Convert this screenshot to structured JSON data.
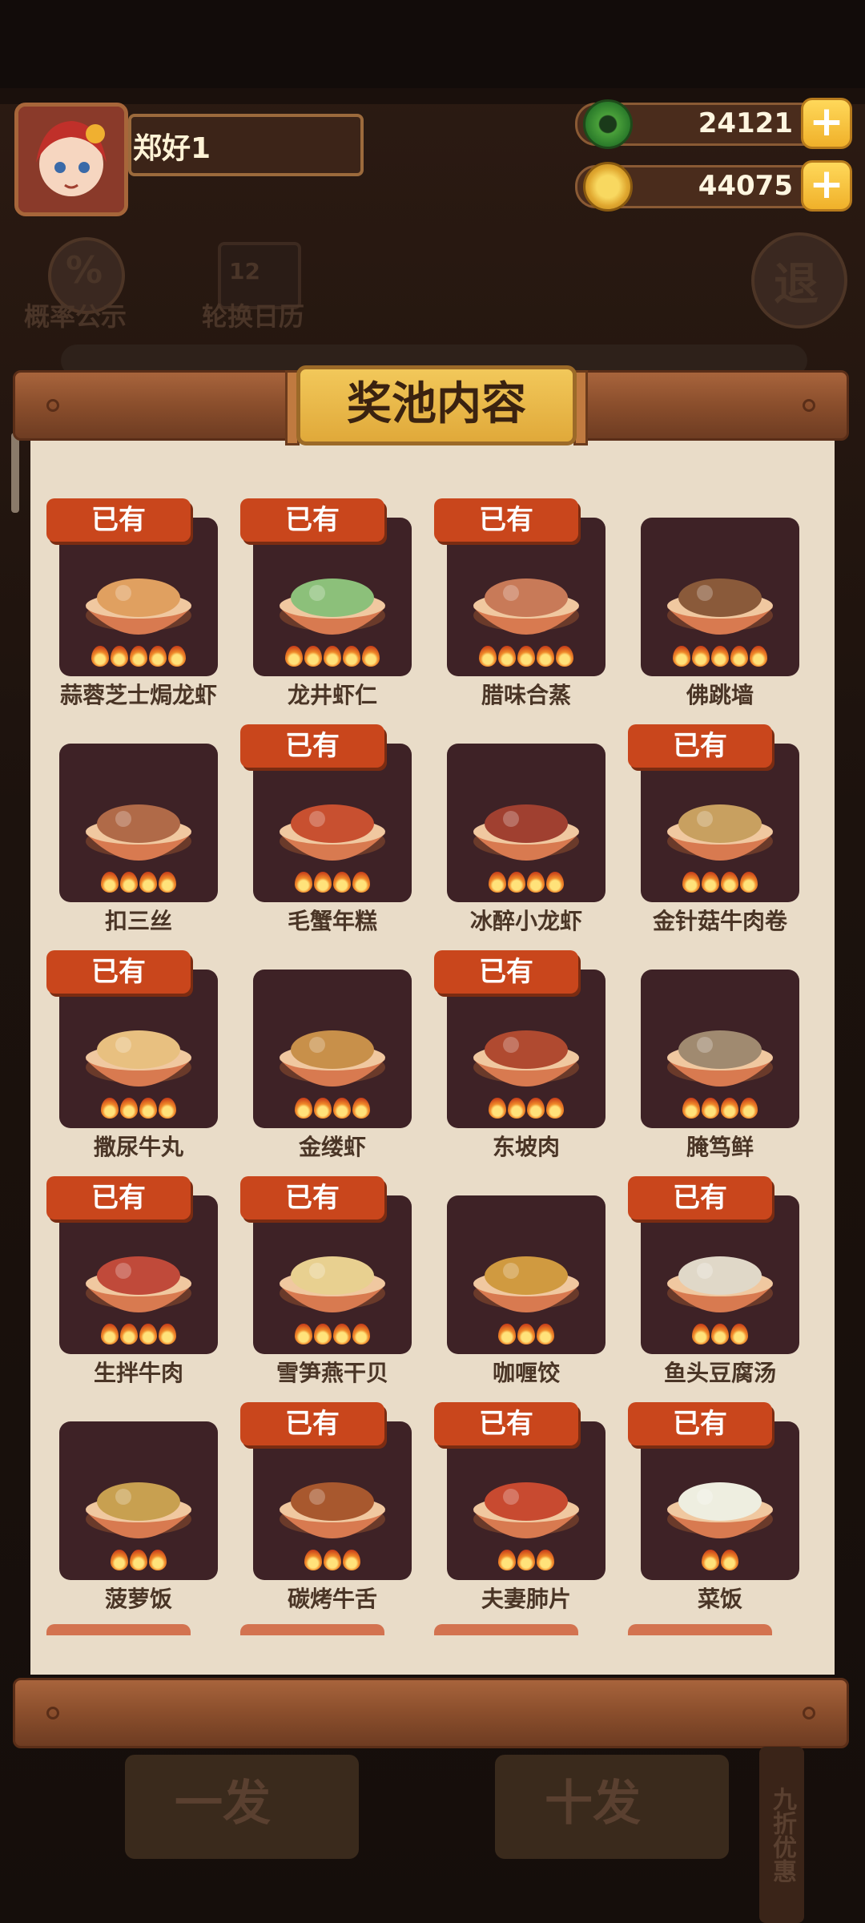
{
  "player": {
    "name": "郑好1"
  },
  "currency": {
    "jade": "24121",
    "coins": "44075",
    "plus_label": "+"
  },
  "toolbar": {
    "probability_label": "概率公示",
    "probability_symbol": "%",
    "calendar_label": "轮换日历",
    "calendar_num": "12",
    "exit_label": "退"
  },
  "panel": {
    "title": "奖池内容"
  },
  "owned_label": "已有",
  "dishes": [
    {
      "name": "蒜蓉芝士焗龙虾",
      "owned": true,
      "flames": 5,
      "color": "#e0a060"
    },
    {
      "name": "龙井虾仁",
      "owned": true,
      "flames": 5,
      "color": "#8cc07a"
    },
    {
      "name": "腊味合蒸",
      "owned": true,
      "flames": 5,
      "color": "#c87a58"
    },
    {
      "name": "佛跳墙",
      "owned": false,
      "flames": 5,
      "color": "#8a5a3a"
    },
    {
      "name": "扣三丝",
      "owned": false,
      "flames": 4,
      "color": "#b06a48"
    },
    {
      "name": "毛蟹年糕",
      "owned": true,
      "flames": 4,
      "color": "#c85030"
    },
    {
      "name": "冰醉小龙虾",
      "owned": false,
      "flames": 4,
      "color": "#a04030"
    },
    {
      "name": "金针菇牛肉卷",
      "owned": true,
      "flames": 4,
      "color": "#c8a060"
    },
    {
      "name": "撒尿牛丸",
      "owned": true,
      "flames": 4,
      "color": "#e8c080"
    },
    {
      "name": "金缕虾",
      "owned": false,
      "flames": 4,
      "color": "#c8904a"
    },
    {
      "name": "东坡肉",
      "owned": true,
      "flames": 4,
      "color": "#b04a30"
    },
    {
      "name": "腌笃鲜",
      "owned": false,
      "flames": 4,
      "color": "#a08a70"
    },
    {
      "name": "生拌牛肉",
      "owned": true,
      "flames": 4,
      "color": "#c04a3a"
    },
    {
      "name": "雪笋燕干贝",
      "owned": true,
      "flames": 4,
      "color": "#e8d090"
    },
    {
      "name": "咖喱饺",
      "owned": false,
      "flames": 3,
      "color": "#d09a40"
    },
    {
      "name": "鱼头豆腐汤",
      "owned": true,
      "flames": 3,
      "color": "#e0d8c8"
    },
    {
      "name": "菠萝饭",
      "owned": false,
      "flames": 3,
      "color": "#c8a050"
    },
    {
      "name": "碳烤牛舌",
      "owned": true,
      "flames": 3,
      "color": "#a8582e"
    },
    {
      "name": "夫妻肺片",
      "owned": true,
      "flames": 3,
      "color": "#c84a30"
    },
    {
      "name": "菜饭",
      "owned": true,
      "flames": 2,
      "color": "#eeeee0"
    }
  ],
  "bottom": {
    "single_label": "一发",
    "ten_label": "十发",
    "discount_label": "九折优惠"
  }
}
